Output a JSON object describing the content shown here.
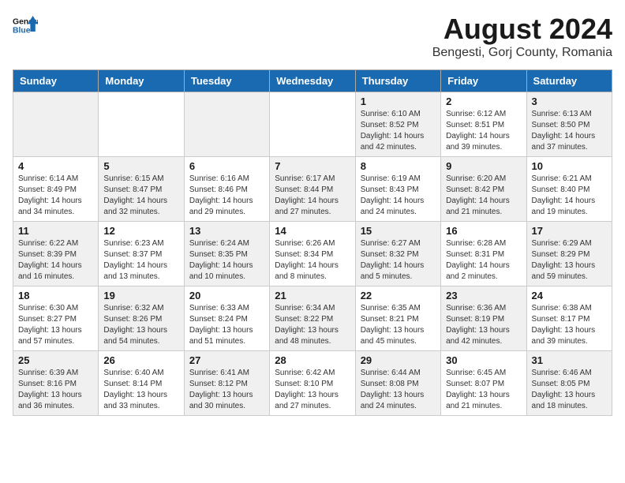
{
  "header": {
    "logo_general": "General",
    "logo_blue": "Blue",
    "month_year": "August 2024",
    "location": "Bengesti, Gorj County, Romania"
  },
  "weekdays": [
    "Sunday",
    "Monday",
    "Tuesday",
    "Wednesday",
    "Thursday",
    "Friday",
    "Saturday"
  ],
  "weeks": [
    [
      {
        "day": "",
        "info": ""
      },
      {
        "day": "",
        "info": ""
      },
      {
        "day": "",
        "info": ""
      },
      {
        "day": "",
        "info": ""
      },
      {
        "day": "1",
        "info": "Sunrise: 6:10 AM\nSunset: 8:52 PM\nDaylight: 14 hours\nand 42 minutes."
      },
      {
        "day": "2",
        "info": "Sunrise: 6:12 AM\nSunset: 8:51 PM\nDaylight: 14 hours\nand 39 minutes."
      },
      {
        "day": "3",
        "info": "Sunrise: 6:13 AM\nSunset: 8:50 PM\nDaylight: 14 hours\nand 37 minutes."
      }
    ],
    [
      {
        "day": "4",
        "info": "Sunrise: 6:14 AM\nSunset: 8:49 PM\nDaylight: 14 hours\nand 34 minutes."
      },
      {
        "day": "5",
        "info": "Sunrise: 6:15 AM\nSunset: 8:47 PM\nDaylight: 14 hours\nand 32 minutes."
      },
      {
        "day": "6",
        "info": "Sunrise: 6:16 AM\nSunset: 8:46 PM\nDaylight: 14 hours\nand 29 minutes."
      },
      {
        "day": "7",
        "info": "Sunrise: 6:17 AM\nSunset: 8:44 PM\nDaylight: 14 hours\nand 27 minutes."
      },
      {
        "day": "8",
        "info": "Sunrise: 6:19 AM\nSunset: 8:43 PM\nDaylight: 14 hours\nand 24 minutes."
      },
      {
        "day": "9",
        "info": "Sunrise: 6:20 AM\nSunset: 8:42 PM\nDaylight: 14 hours\nand 21 minutes."
      },
      {
        "day": "10",
        "info": "Sunrise: 6:21 AM\nSunset: 8:40 PM\nDaylight: 14 hours\nand 19 minutes."
      }
    ],
    [
      {
        "day": "11",
        "info": "Sunrise: 6:22 AM\nSunset: 8:39 PM\nDaylight: 14 hours\nand 16 minutes."
      },
      {
        "day": "12",
        "info": "Sunrise: 6:23 AM\nSunset: 8:37 PM\nDaylight: 14 hours\nand 13 minutes."
      },
      {
        "day": "13",
        "info": "Sunrise: 6:24 AM\nSunset: 8:35 PM\nDaylight: 14 hours\nand 10 minutes."
      },
      {
        "day": "14",
        "info": "Sunrise: 6:26 AM\nSunset: 8:34 PM\nDaylight: 14 hours\nand 8 minutes."
      },
      {
        "day": "15",
        "info": "Sunrise: 6:27 AM\nSunset: 8:32 PM\nDaylight: 14 hours\nand 5 minutes."
      },
      {
        "day": "16",
        "info": "Sunrise: 6:28 AM\nSunset: 8:31 PM\nDaylight: 14 hours\nand 2 minutes."
      },
      {
        "day": "17",
        "info": "Sunrise: 6:29 AM\nSunset: 8:29 PM\nDaylight: 13 hours\nand 59 minutes."
      }
    ],
    [
      {
        "day": "18",
        "info": "Sunrise: 6:30 AM\nSunset: 8:27 PM\nDaylight: 13 hours\nand 57 minutes."
      },
      {
        "day": "19",
        "info": "Sunrise: 6:32 AM\nSunset: 8:26 PM\nDaylight: 13 hours\nand 54 minutes."
      },
      {
        "day": "20",
        "info": "Sunrise: 6:33 AM\nSunset: 8:24 PM\nDaylight: 13 hours\nand 51 minutes."
      },
      {
        "day": "21",
        "info": "Sunrise: 6:34 AM\nSunset: 8:22 PM\nDaylight: 13 hours\nand 48 minutes."
      },
      {
        "day": "22",
        "info": "Sunrise: 6:35 AM\nSunset: 8:21 PM\nDaylight: 13 hours\nand 45 minutes."
      },
      {
        "day": "23",
        "info": "Sunrise: 6:36 AM\nSunset: 8:19 PM\nDaylight: 13 hours\nand 42 minutes."
      },
      {
        "day": "24",
        "info": "Sunrise: 6:38 AM\nSunset: 8:17 PM\nDaylight: 13 hours\nand 39 minutes."
      }
    ],
    [
      {
        "day": "25",
        "info": "Sunrise: 6:39 AM\nSunset: 8:16 PM\nDaylight: 13 hours\nand 36 minutes."
      },
      {
        "day": "26",
        "info": "Sunrise: 6:40 AM\nSunset: 8:14 PM\nDaylight: 13 hours\nand 33 minutes."
      },
      {
        "day": "27",
        "info": "Sunrise: 6:41 AM\nSunset: 8:12 PM\nDaylight: 13 hours\nand 30 minutes."
      },
      {
        "day": "28",
        "info": "Sunrise: 6:42 AM\nSunset: 8:10 PM\nDaylight: 13 hours\nand 27 minutes."
      },
      {
        "day": "29",
        "info": "Sunrise: 6:44 AM\nSunset: 8:08 PM\nDaylight: 13 hours\nand 24 minutes."
      },
      {
        "day": "30",
        "info": "Sunrise: 6:45 AM\nSunset: 8:07 PM\nDaylight: 13 hours\nand 21 minutes."
      },
      {
        "day": "31",
        "info": "Sunrise: 6:46 AM\nSunset: 8:05 PM\nDaylight: 13 hours\nand 18 minutes."
      }
    ]
  ]
}
